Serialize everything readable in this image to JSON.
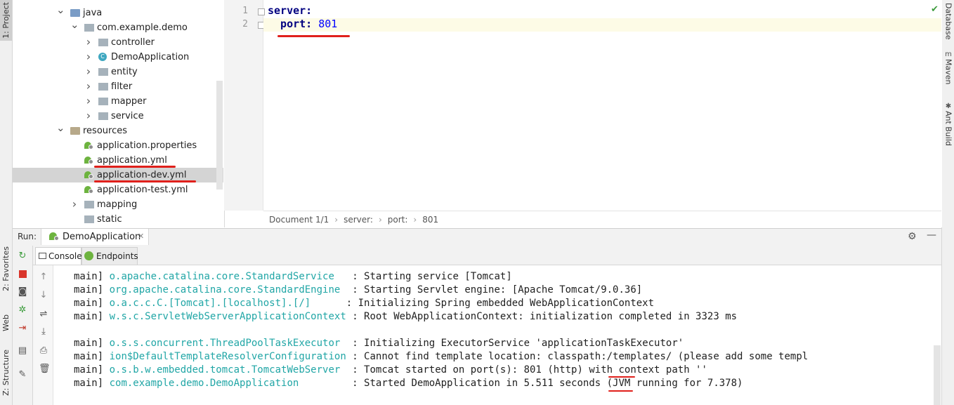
{
  "left_strip": {
    "project": "1: Project",
    "favorites": "2: Favorites",
    "web": "Web",
    "structure": "Z: Structure"
  },
  "right_strip": {
    "database": "Database",
    "maven": "Maven",
    "ant": "Ant Build"
  },
  "tree": [
    {
      "label": "java",
      "indent": 1,
      "arrow": "down",
      "icon": "folder-src"
    },
    {
      "label": "com.example.demo",
      "indent": 2,
      "arrow": "down",
      "icon": "package"
    },
    {
      "label": "controller",
      "indent": 3,
      "arrow": "right",
      "icon": "package"
    },
    {
      "label": "DemoApplication",
      "indent": 3,
      "arrow": "right",
      "icon": "class"
    },
    {
      "label": "entity",
      "indent": 3,
      "arrow": "right",
      "icon": "package"
    },
    {
      "label": "filter",
      "indent": 3,
      "arrow": "right",
      "icon": "package"
    },
    {
      "label": "mapper",
      "indent": 3,
      "arrow": "right",
      "icon": "package"
    },
    {
      "label": "service",
      "indent": 3,
      "arrow": "right",
      "icon": "package"
    },
    {
      "label": "resources",
      "indent": 1,
      "arrow": "down",
      "icon": "folder-res"
    },
    {
      "label": "application.properties",
      "indent": 2,
      "arrow": "",
      "icon": "spring"
    },
    {
      "label": "application.yml",
      "indent": 2,
      "arrow": "",
      "icon": "spring",
      "underlined": true
    },
    {
      "label": "application-dev.yml",
      "indent": 2,
      "arrow": "",
      "icon": "spring",
      "selected": true,
      "underlined": true
    },
    {
      "label": "application-test.yml",
      "indent": 2,
      "arrow": "",
      "icon": "spring"
    },
    {
      "label": "mapping",
      "indent": 2,
      "arrow": "right",
      "icon": "package"
    },
    {
      "label": "static",
      "indent": 2,
      "arrow": "",
      "icon": "package"
    }
  ],
  "editor": {
    "lines": [
      {
        "number": "1",
        "key": "server:",
        "value": ""
      },
      {
        "number": "2",
        "key": "  port:",
        "value": " 801"
      }
    ],
    "breadcrumb": [
      "Document 1/1",
      "server:",
      "port:",
      "801"
    ]
  },
  "run": {
    "label": "Run:",
    "tab": "DemoApplication",
    "console_tab": "Console",
    "endpoints_tab": "Endpoints"
  },
  "console_lines": [
    {
      "thread": "main]",
      "logger": "o.apache.catalina.core.StandardService",
      "pad": "   ",
      "message": ": Starting service [Tomcat]"
    },
    {
      "thread": "main]",
      "logger": "org.apache.catalina.core.StandardEngine",
      "pad": "  ",
      "message": ": Starting Servlet engine: [Apache Tomcat/9.0.36]"
    },
    {
      "thread": "main]",
      "logger": "o.a.c.c.C.[Tomcat].[localhost].[/]",
      "pad": "      ",
      "message": ": Initializing Spring embedded WebApplicationContext"
    },
    {
      "thread": "main]",
      "logger": "w.s.c.ServletWebServerApplicationContext",
      "pad": " ",
      "message": ": Root WebApplicationContext: initialization completed in 3323 ms"
    },
    {
      "thread": "",
      "logger": "",
      "pad": "",
      "message": ""
    },
    {
      "thread": "main]",
      "logger": "o.s.s.concurrent.ThreadPoolTaskExecutor",
      "pad": "  ",
      "message": ": Initializing ExecutorService 'applicationTaskExecutor'"
    },
    {
      "thread": "main]",
      "logger": "ion$DefaultTemplateResolverConfiguration",
      "pad": " ",
      "message": ": Cannot find template location: classpath:/templates/ (please add some templ"
    },
    {
      "thread": "main]",
      "logger": "o.s.b.w.embedded.tomcat.TomcatWebServer",
      "pad": "  ",
      "message": ": Tomcat started on port(s): 801 (http) with context path ''"
    },
    {
      "thread": "main]",
      "logger": "com.example.demo.DemoApplication",
      "pad": "         ",
      "message": ": Started DemoApplication in 5.511 seconds (JVM running for 7.378)"
    }
  ]
}
